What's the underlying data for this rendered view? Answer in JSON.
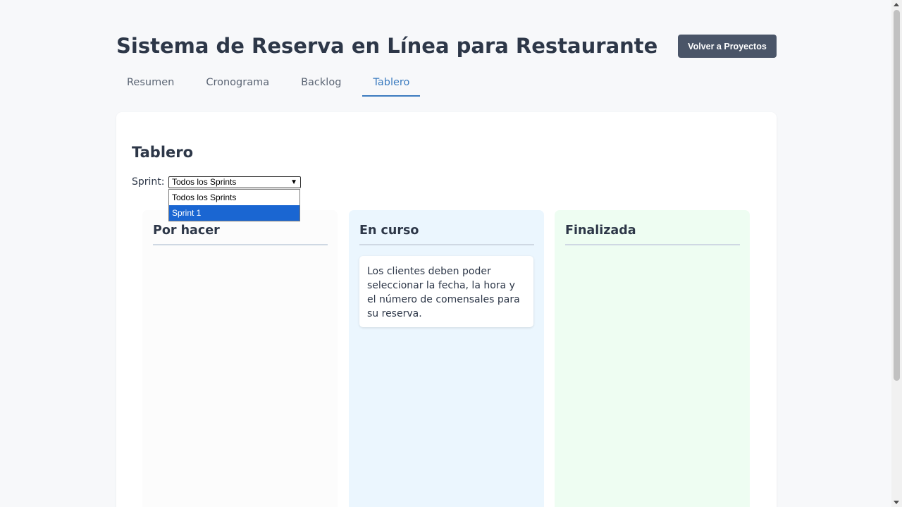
{
  "header": {
    "title": "Sistema de Reserva en Línea para Restaurante",
    "back_button_label": "Volver a Proyectos"
  },
  "tabs": [
    {
      "label": "Resumen",
      "active": false
    },
    {
      "label": "Cronograma",
      "active": false
    },
    {
      "label": "Backlog",
      "active": false
    },
    {
      "label": "Tablero",
      "active": true
    }
  ],
  "board": {
    "title": "Tablero",
    "sprint_label": "Sprint:",
    "sprint_select": {
      "selected": "Todos los Sprints",
      "options": [
        "Todos los Sprints",
        "Sprint 1"
      ],
      "highlighted": "Sprint 1"
    },
    "columns": [
      {
        "title": "Por hacer",
        "cards": []
      },
      {
        "title": "En curso",
        "cards": [
          "Los clientes deben poder seleccionar la fecha, la hora y el número de comensales para su reserva."
        ]
      },
      {
        "title": "Finalizada",
        "cards": []
      }
    ]
  },
  "colors": {
    "accent": "#3b7bbf",
    "button_bg": "#4a5568",
    "todo_bg": "#fcfcfc",
    "doing_bg": "#ebf6fe",
    "done_bg": "#eefdf2",
    "dropdown_highlight": "#1a66d2"
  }
}
